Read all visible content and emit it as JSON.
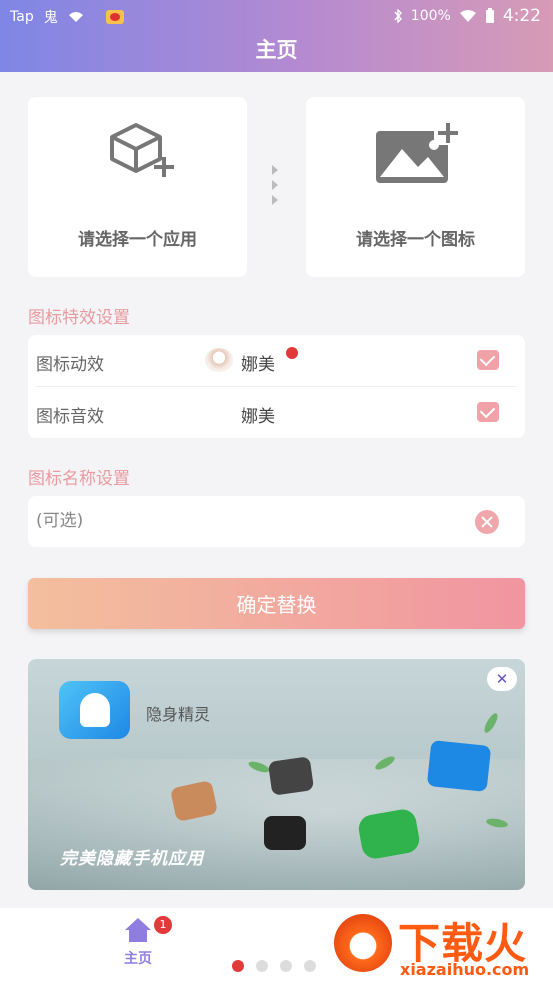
{
  "status_bar": {
    "left_items": [
      "Tap",
      "鬼"
    ],
    "battery": "100%",
    "time": "4:22"
  },
  "header": {
    "title": "主页"
  },
  "pickers": {
    "app_label": "请选择一个应用",
    "icon_label": "请选择一个图标"
  },
  "effects_section": {
    "title": "图标特效设置",
    "rows": [
      {
        "label": "图标动效",
        "value": "娜美",
        "checked": true
      },
      {
        "label": "图标音效",
        "value": "娜美",
        "checked": true
      }
    ]
  },
  "name_section": {
    "title": "图标名称设置",
    "placeholder": "(可选)"
  },
  "confirm_button": "确定替换",
  "banner": {
    "app_name": "隐身精灵",
    "close": "✕",
    "slogan": "完美隐藏手机应用"
  },
  "bottom_nav": {
    "home_label": "主页",
    "home_badge": "1",
    "pager_active_index": 0,
    "pager_count": 4
  },
  "watermark": {
    "brand": "下载火",
    "url": "xiazaihuo.com"
  },
  "colors": {
    "accent": "#8f7ee0",
    "section_title": "#e89aa0",
    "checkbox": "#f0a2a8"
  }
}
